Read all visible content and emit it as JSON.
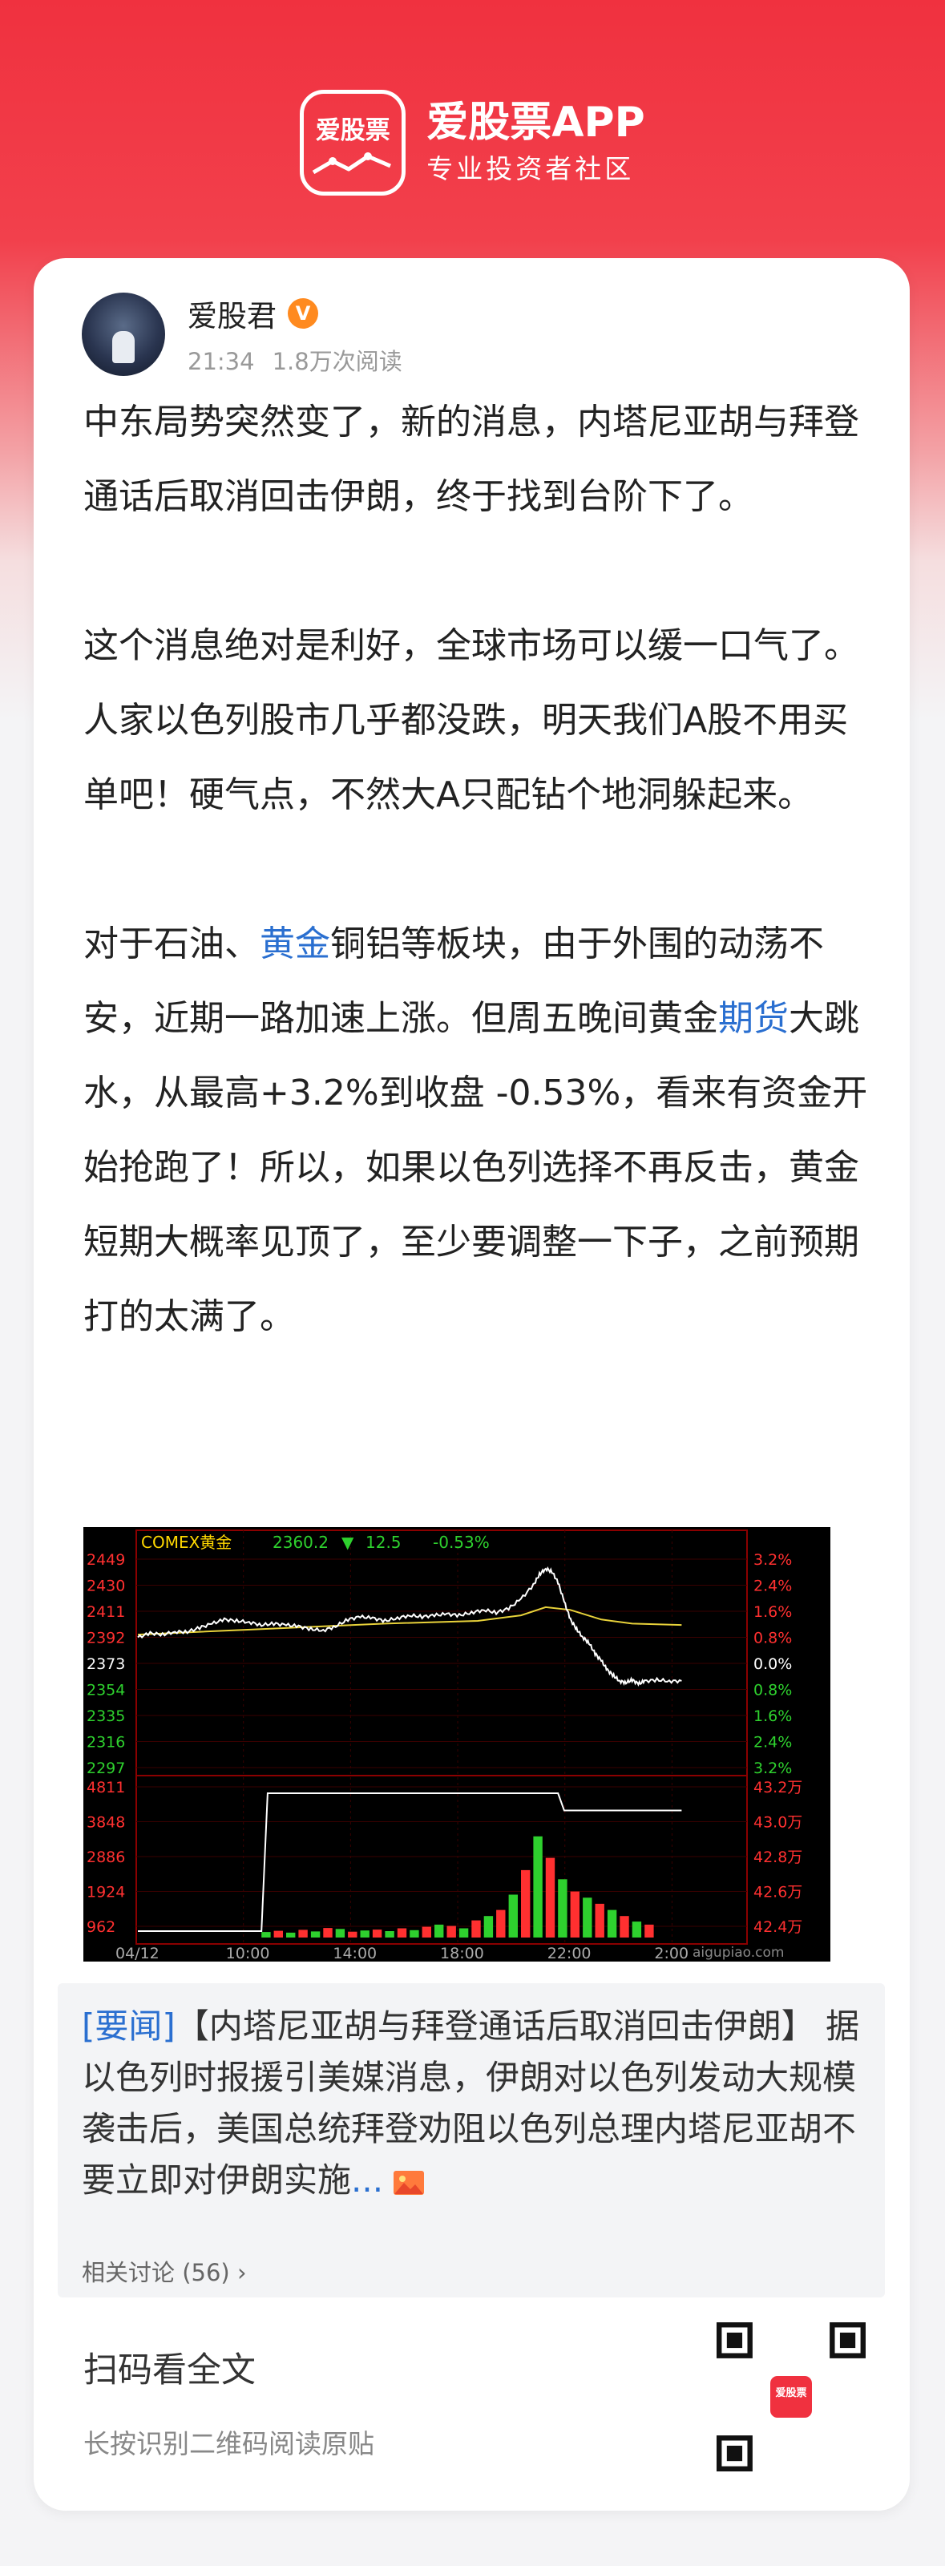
{
  "brand": {
    "logo_text": "爱股票",
    "title": "爱股票APP",
    "subtitle": "专业投资者社区"
  },
  "author": {
    "name": "爱股君",
    "badge": "V",
    "time": "21:34",
    "reads": "1.8万次阅读"
  },
  "post": {
    "p1": "中东局势突然变了，新的消息，内塔尼亚胡与拜登通话后取消回击伊朗，终于找到台阶下了。",
    "p2": "这个消息绝对是利好，全球市场可以缓一口气了。人家以色列股市几乎都没跌，明天我们A股不用买单吧！硬气点，不然大A只配钻个地洞躲起来。",
    "p3_a": "对于石油、",
    "p3_link1": "黄金",
    "p3_b": "铜铝等板块，由于外围的动荡不安，近期一路加速上涨。但周五晚间黄金",
    "p3_link2": "期货",
    "p3_c": "大跳水，从最高+3.2%到收盘 -0.53%，看来有资金开始抢跑了！所以，如果以色列选择不再反击，黄金短期大概率见顶了，至少要调整一下子，之前预期打的太满了。"
  },
  "chart": {
    "header_name": "COMEX黄金",
    "header_price": "2360.2",
    "header_change_arrow": "▼",
    "header_change": "12.5",
    "header_pct": "-0.53%",
    "watermark": "aigupiao.com",
    "colors": {
      "up": "#ff3030",
      "down": "#2ed12e",
      "price": "#ffffff",
      "avg": "#e8d23a",
      "flat": "#ffffff",
      "axis": "#8b0000",
      "header": "#ffd800"
    }
  },
  "chart_data": {
    "type": "line",
    "title": "COMEX黄金",
    "x_ticks": [
      "04/12",
      "10:00",
      "14:00",
      "18:00",
      "22:00",
      "2:00"
    ],
    "price_ticks": [
      "2449",
      "2430",
      "2411",
      "2392",
      "2373",
      "2354",
      "2335",
      "2316",
      "2297"
    ],
    "pct_ticks": [
      "3.2%",
      "2.4%",
      "1.6%",
      "0.8%",
      "0.0%",
      "0.8%",
      "1.6%",
      "2.4%",
      "3.2%"
    ],
    "volume_ticks": [
      "4811",
      "3848",
      "2886",
      "1924",
      "962"
    ],
    "oi_ticks": [
      "43.2万",
      "43.0万",
      "42.8万",
      "42.6万",
      "42.4万"
    ],
    "price_range": [
      2297,
      2449
    ],
    "price_series": [
      [
        0,
        2392
      ],
      [
        2,
        2395
      ],
      [
        4,
        2394
      ],
      [
        6,
        2396
      ],
      [
        8,
        2396
      ],
      [
        10,
        2399
      ],
      [
        12,
        2402
      ],
      [
        14,
        2405
      ],
      [
        16,
        2404
      ],
      [
        18,
        2403
      ],
      [
        20,
        2401
      ],
      [
        22,
        2402
      ],
      [
        24,
        2401
      ],
      [
        26,
        2400
      ],
      [
        28,
        2398
      ],
      [
        30,
        2397
      ],
      [
        32,
        2400
      ],
      [
        34,
        2405
      ],
      [
        36,
        2407
      ],
      [
        38,
        2406
      ],
      [
        40,
        2404
      ],
      [
        42,
        2406
      ],
      [
        44,
        2408
      ],
      [
        46,
        2407
      ],
      [
        48,
        2408
      ],
      [
        50,
        2409
      ],
      [
        52,
        2408
      ],
      [
        54,
        2410
      ],
      [
        56,
        2412
      ],
      [
        58,
        2410
      ],
      [
        60,
        2413
      ],
      [
        62,
        2420
      ],
      [
        64,
        2430
      ],
      [
        65,
        2438
      ],
      [
        66,
        2442
      ],
      [
        67,
        2440
      ],
      [
        68,
        2432
      ],
      [
        69,
        2418
      ],
      [
        70,
        2405
      ],
      [
        71,
        2398
      ],
      [
        72,
        2392
      ],
      [
        73,
        2388
      ],
      [
        74,
        2380
      ],
      [
        75,
        2375
      ],
      [
        76,
        2368
      ],
      [
        77,
        2364
      ],
      [
        78,
        2360
      ],
      [
        79,
        2359
      ],
      [
        80,
        2361
      ],
      [
        81,
        2358
      ],
      [
        82,
        2360
      ],
      [
        84,
        2361
      ],
      [
        86,
        2360
      ],
      [
        88,
        2360.2
      ]
    ],
    "avg_series": [
      [
        0,
        2394
      ],
      [
        20,
        2398
      ],
      [
        40,
        2402
      ],
      [
        55,
        2404
      ],
      [
        62,
        2408
      ],
      [
        66,
        2414
      ],
      [
        70,
        2412
      ],
      [
        75,
        2405
      ],
      [
        80,
        2402
      ],
      [
        88,
        2401
      ]
    ],
    "volume": [
      {
        "v": 180,
        "c": "g"
      },
      {
        "v": 220,
        "c": "r"
      },
      {
        "v": 160,
        "c": "g"
      },
      {
        "v": 250,
        "c": "r"
      },
      {
        "v": 200,
        "c": "g"
      },
      {
        "v": 310,
        "c": "r"
      },
      {
        "v": 280,
        "c": "g"
      },
      {
        "v": 190,
        "c": "r"
      },
      {
        "v": 230,
        "c": "g"
      },
      {
        "v": 260,
        "c": "r"
      },
      {
        "v": 210,
        "c": "g"
      },
      {
        "v": 300,
        "c": "r"
      },
      {
        "v": 240,
        "c": "g"
      },
      {
        "v": 350,
        "c": "r"
      },
      {
        "v": 420,
        "c": "g"
      },
      {
        "v": 380,
        "c": "r"
      },
      {
        "v": 300,
        "c": "g"
      },
      {
        "v": 560,
        "c": "r"
      },
      {
        "v": 700,
        "c": "g"
      },
      {
        "v": 900,
        "c": "r"
      },
      {
        "v": 1400,
        "c": "g"
      },
      {
        "v": 2200,
        "c": "r"
      },
      {
        "v": 3300,
        "c": "g"
      },
      {
        "v": 2600,
        "c": "r"
      },
      {
        "v": 1900,
        "c": "g"
      },
      {
        "v": 1500,
        "c": "r"
      },
      {
        "v": 1300,
        "c": "g"
      },
      {
        "v": 1100,
        "c": "r"
      },
      {
        "v": 900,
        "c": "g"
      },
      {
        "v": 700,
        "c": "r"
      },
      {
        "v": 520,
        "c": "g"
      },
      {
        "v": 420,
        "c": "r"
      }
    ],
    "open_interest_wan": [
      [
        0,
        42.4
      ],
      [
        20,
        42.4
      ],
      [
        21,
        43.2
      ],
      [
        68,
        43.2
      ],
      [
        69,
        43.1
      ],
      [
        88,
        43.1
      ]
    ]
  },
  "news": {
    "tag": "[要闻]",
    "headline": "【内塔尼亚胡与拜登通话后取消回击伊朗】",
    "body": " 据以色列时报援引美媒消息，伊朗对以色列发动大规模袭击后，美国总统拜登劝阻以色列总理内塔尼亚胡不要立即对伊朗实施",
    "ellipsis": "...",
    "related": "相关讨论 (56) ›"
  },
  "qr": {
    "title": "扫码看全文",
    "subtitle": "长按识别二维码阅读原贴",
    "center_text": "爱股票"
  }
}
